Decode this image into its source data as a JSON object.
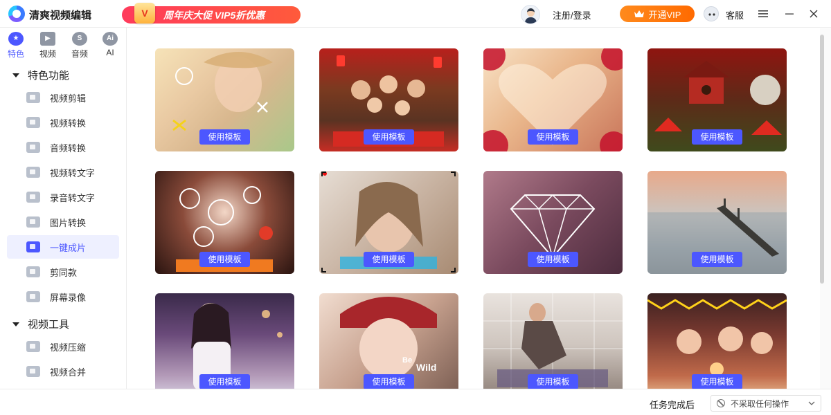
{
  "app": {
    "title": "清爽视频编辑",
    "promo_gift": "V",
    "promo_text": "周年庆大促 VIP5折优惠",
    "login": "注册/登录",
    "vip_button": "开通VIP",
    "service": "客服"
  },
  "sidebar": {
    "tabs": [
      {
        "label": "特色",
        "icon": "star-icon",
        "glyph": "★",
        "active": true
      },
      {
        "label": "视频",
        "icon": "film-icon",
        "glyph": "▶"
      },
      {
        "label": "音频",
        "icon": "audio-icon",
        "glyph": "S"
      },
      {
        "label": "AI",
        "icon": "ai-icon",
        "glyph": "Ai"
      }
    ],
    "sections": [
      {
        "title": "特色功能"
      },
      {
        "title": "视频工具"
      }
    ],
    "items": [
      {
        "label": "视频剪辑",
        "icon": "video-edit-icon"
      },
      {
        "label": "视频转换",
        "icon": "video-convert-icon"
      },
      {
        "label": "音频转换",
        "icon": "microphone-icon"
      },
      {
        "label": "视频转文字",
        "icon": "video-to-text-icon"
      },
      {
        "label": "录音转文字",
        "icon": "recording-to-text-icon"
      },
      {
        "label": "图片转换",
        "icon": "image-convert-icon"
      },
      {
        "label": "一键成片",
        "icon": "one-click-video-icon",
        "active": true
      },
      {
        "label": "剪同款",
        "icon": "template-cut-icon"
      },
      {
        "label": "屏幕录像",
        "icon": "screen-record-icon"
      },
      {
        "label": "视频压缩",
        "icon": "video-compress-icon"
      },
      {
        "label": "视频合并",
        "icon": "video-merge-icon"
      }
    ]
  },
  "grid": {
    "use_template_label": "使用模板",
    "cards": [
      {
        "name": "template-sunny-girl"
      },
      {
        "name": "template-family-dinner"
      },
      {
        "name": "template-hearts-couple"
      },
      {
        "name": "template-birdhouse-newyear"
      },
      {
        "name": "template-snowflake-lights"
      },
      {
        "name": "template-rec-portrait"
      },
      {
        "name": "template-shine-diamond"
      },
      {
        "name": "template-adventure-pier"
      },
      {
        "name": "template-night-girl"
      },
      {
        "name": "template-be-wild"
      },
      {
        "name": "template-leading-fashion"
      },
      {
        "name": "template-birthday-party"
      }
    ]
  },
  "bottom": {
    "after_label": "任务完成后",
    "after_value": "不采取任何操作"
  },
  "colors": {
    "accent": "#4c57ff",
    "vip": "#ff7a12",
    "promo": "#ff3b5c"
  }
}
